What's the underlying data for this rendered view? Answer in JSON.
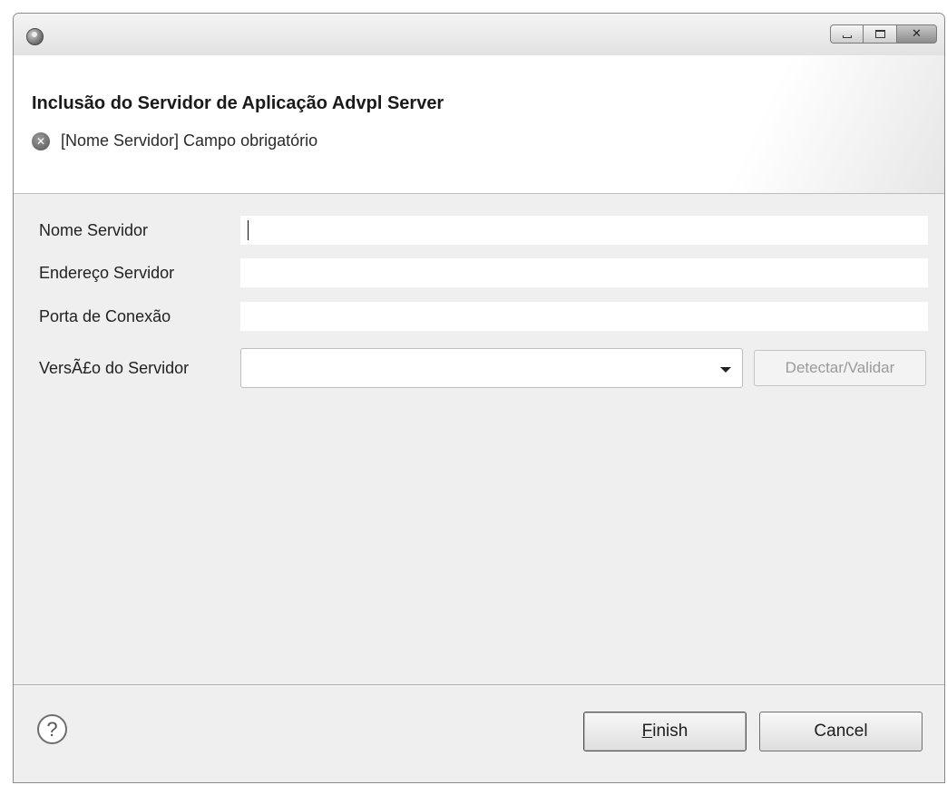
{
  "window": {
    "controls": {
      "minimize": "minimize",
      "maximize": "maximize",
      "close": "✕"
    },
    "app_icon": "eclipse-icon"
  },
  "banner": {
    "title": "Inclusão do Servidor de Aplicação Advpl Server",
    "message": "[Nome Servidor] Campo obrigatório",
    "message_icon": "error-icon"
  },
  "form": {
    "fields": [
      {
        "label": "Nome Servidor",
        "value": ""
      },
      {
        "label": "Endereço Servidor",
        "value": ""
      },
      {
        "label": "Porta de Conexão",
        "value": ""
      }
    ],
    "version": {
      "label": "VersÃ£o do Servidor",
      "value": ""
    },
    "detect_button": "Detectar/Validar"
  },
  "footer": {
    "help": "?",
    "finish_first": "F",
    "finish_rest": "inish",
    "cancel": "Cancel"
  }
}
